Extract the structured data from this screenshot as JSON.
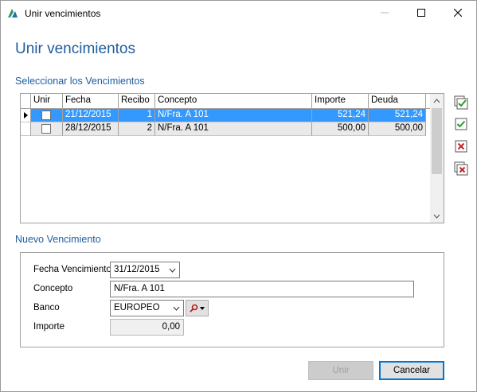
{
  "window": {
    "title": "Unir vencimientos",
    "controls": {
      "minimize_icon": "minimize-icon",
      "maximize_icon": "maximize-icon",
      "close_icon": "close-icon"
    }
  },
  "heading": "Unir vencimientos",
  "select_section": {
    "label": "Seleccionar los Vencimientos",
    "columns": [
      "Unir",
      "Fecha",
      "Recibo",
      "Concepto",
      "Importe",
      "Deuda"
    ],
    "rows": [
      {
        "unir": false,
        "fecha": "21/12/2015",
        "recibo": "1",
        "concepto": "N/Fra. A 101",
        "importe": "521,24",
        "deuda": "521,24",
        "selected": true
      },
      {
        "unir": false,
        "fecha": "28/12/2015",
        "recibo": "2",
        "concepto": "N/Fra. A 101",
        "importe": "500,00",
        "deuda": "500,00",
        "selected": false
      }
    ],
    "side_actions": [
      "check-all-icon",
      "check-icon",
      "uncheck-icon",
      "uncheck-all-icon"
    ]
  },
  "new_section": {
    "label": "Nuevo Vencimiento",
    "fecha_label": "Fecha Vencimiento",
    "fecha_value": "31/12/2015",
    "concepto_label": "Concepto",
    "concepto_value": "N/Fra. A 101",
    "banco_label": "Banco",
    "banco_value": "EUROPEO",
    "importe_label": "Importe",
    "importe_value": "0,00"
  },
  "buttons": {
    "unir": "Unir",
    "cancelar": "Cancelar"
  },
  "colors": {
    "accent": "#1f5c9e",
    "selection": "#3399ff",
    "check_green": "#2e9b2e",
    "delete_red": "#c0282a"
  }
}
